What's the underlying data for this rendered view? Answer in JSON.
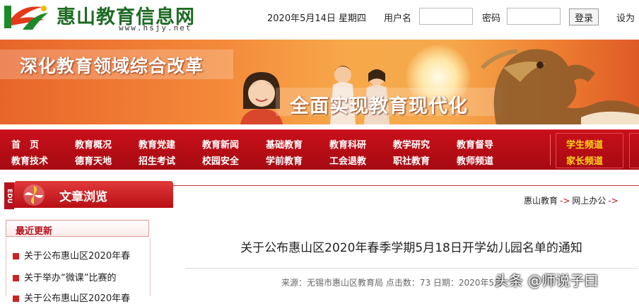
{
  "header": {
    "site_name": "惠山教育信息网",
    "site_url": "www.hsjy.net",
    "date": "2020年5月14日 星期四",
    "username_label": "用户名",
    "password_label": "密码",
    "login_button": "登录",
    "set_home": "设为"
  },
  "banner": {
    "slogan1": "深化教育领域综合改革",
    "slogan2": "全面实现教育现代化"
  },
  "nav": {
    "row1": [
      "首　页",
      "教育概况",
      "教育党建",
      "教育新闻",
      "基础教育",
      "教育科研",
      "教学研究",
      "教育督导"
    ],
    "row2": [
      "教育技术",
      "德育天地",
      "招生考试",
      "校园安全",
      "学前教育",
      "工会退教",
      "职社教育",
      "教师频道"
    ],
    "special": [
      "学生频道",
      "家长频道"
    ]
  },
  "panel": {
    "edu": "EDU",
    "title": "文章浏览",
    "breadcrumb": [
      "惠山教育",
      "网上办公",
      ""
    ]
  },
  "sidebar": {
    "title": "最近更新",
    "items": [
      "关于公布惠山区2020年春",
      "关于举办“微课”比赛的",
      "关于公布惠山区2020年春"
    ]
  },
  "article": {
    "title": "关于公布惠山区2020年春季学期5月18日开学幼儿园名单的通知",
    "meta": "来源：无锡市惠山区教育局 点击数：73 日期：2020年5月"
  },
  "watermark": "头条 @师说子曰",
  "colors": {
    "nav_red": "#b5121b",
    "logo_green": "#1d6b24",
    "nav_highlight": "#ffd21a"
  }
}
